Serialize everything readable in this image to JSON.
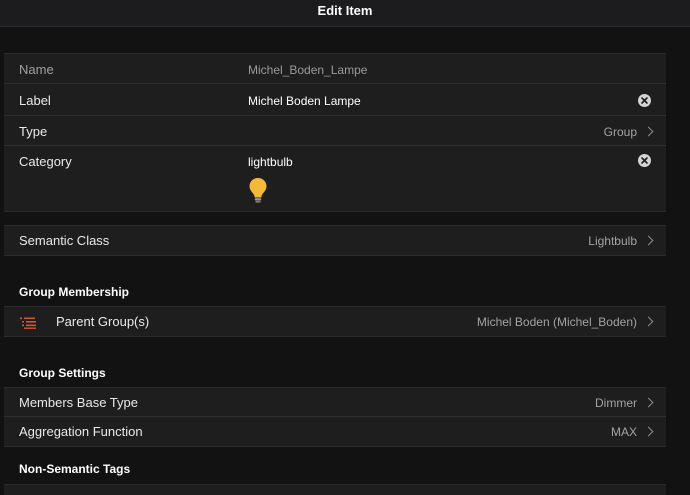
{
  "header": {
    "title": "Edit Item"
  },
  "item": {
    "name_label": "Name",
    "name_value": "Michel_Boden_Lampe",
    "label_label": "Label",
    "label_value": "Michel Boden Lampe",
    "type_label": "Type",
    "type_value": "Group",
    "category_label": "Category",
    "category_value": "lightbulb",
    "category_icon": "lightbulb-icon"
  },
  "semantic": {
    "label": "Semantic Class",
    "value": "Lightbulb"
  },
  "group_membership": {
    "title": "Group Membership",
    "parent_label": "Parent Group(s)",
    "parent_value": "Michel Boden (Michel_Boden)",
    "icon": "list-icon",
    "icon_color": "#d2572f"
  },
  "group_settings": {
    "title": "Group Settings",
    "base_type_label": "Members Base Type",
    "base_type_value": "Dimmer",
    "aggregation_label": "Aggregation Function",
    "aggregation_value": "MAX"
  },
  "tags": {
    "title": "Non-Semantic Tags"
  }
}
